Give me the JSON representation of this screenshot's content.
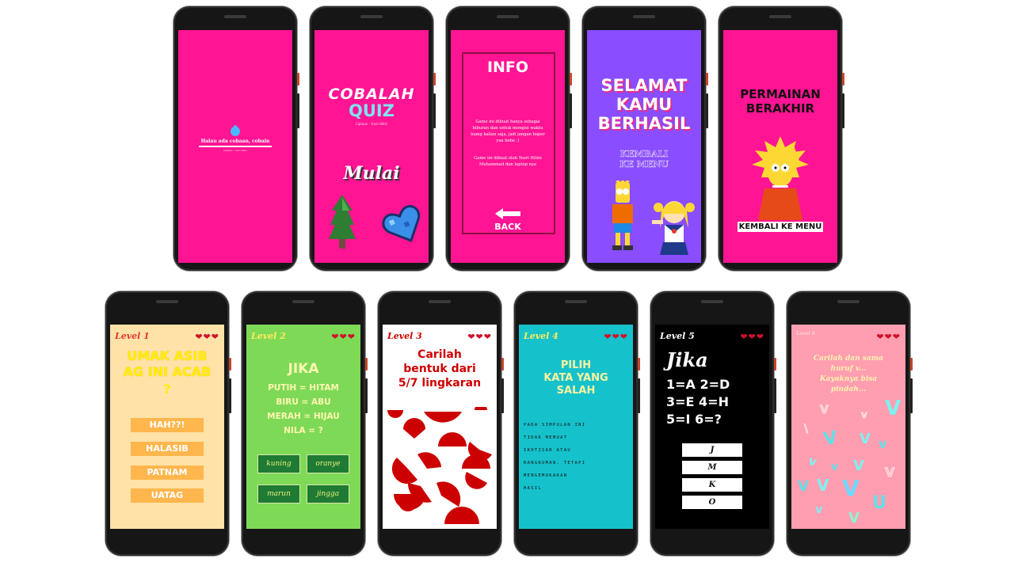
{
  "loading": {
    "text": "Halau ada cobaan, cobain",
    "subtext": "Ciptaan : Yusri Hilmi"
  },
  "title_screen": {
    "line1": "COBALAH",
    "line2": "QUIZ",
    "credit": "Ciptaan : Yusri Hilmi",
    "start": "Mulai"
  },
  "info": {
    "title": "INFO",
    "para1": "Game ini dibuat hanya sebagai hiburan dan untuk mengisi waktu luang kalian saja, jadi jangan baper yaa bebe :)",
    "para2": "Game ini dibuat oleh Yusri Hilmi Muhammad dan laptop nya",
    "back": "BACK"
  },
  "success": {
    "line1": "SELAMAT",
    "line2": "KAMU",
    "line3": "BERHASIL",
    "menu_line1": "KEMBALI",
    "menu_line2": "KE MENU"
  },
  "game_over": {
    "line1": "PERMAINAN",
    "line2": "BERAKHIR",
    "menu": "KEMBALI KE MENU"
  },
  "hearts": "❤❤❤",
  "level1": {
    "label": "Level 1",
    "q1": "UMAK ASIB",
    "q2": "AG INI ACAB",
    "q3": "?",
    "options": [
      "HAH??!",
      "HALASIB",
      "PATNAM",
      "UATAG"
    ]
  },
  "level2": {
    "label": "Level 2",
    "title": "JIKA",
    "l1": "PUTIH = HITAM",
    "l2": "BIRU = ABU",
    "l3": "MERAH = HIJAU",
    "l4": "NILA = ?",
    "options": [
      "kuning",
      "oranye",
      "marun",
      "jingga"
    ]
  },
  "level3": {
    "label": "Level 3",
    "q1": "Carilah",
    "q2": "bentuk dari",
    "q3": "5/7 lingkaran"
  },
  "level4": {
    "label": "Level 4",
    "q1": "PILIH",
    "q2": "KATA YANG",
    "q3": "SALAH",
    "passage": [
      "PADA SIMPULAN INI",
      "TIDAK MEMUAT",
      "IKHTISAR ATAU",
      "RANGKUMAN, TETAPI",
      "MENGEMUKAKAN",
      "HASIL"
    ]
  },
  "level5": {
    "label": "Level 5",
    "l1": "Jika",
    "l2": "1=A 2=D",
    "l3": "3=E 4=H",
    "l4": "5=I 6=?",
    "options": [
      "J",
      "M",
      "K",
      "O"
    ]
  },
  "level6": {
    "label": "Level 6",
    "q1": "Carilah dan sama",
    "q2": "huruf v...",
    "q3": "Kayaknya bisa",
    "q4": "pindah..."
  },
  "colors": {
    "pink": "#ff1493",
    "purple": "#8a4dff",
    "peach": "#ffe2a8",
    "green": "#7ed957",
    "teal": "#15c2cc",
    "rose": "#ff9eb0"
  }
}
